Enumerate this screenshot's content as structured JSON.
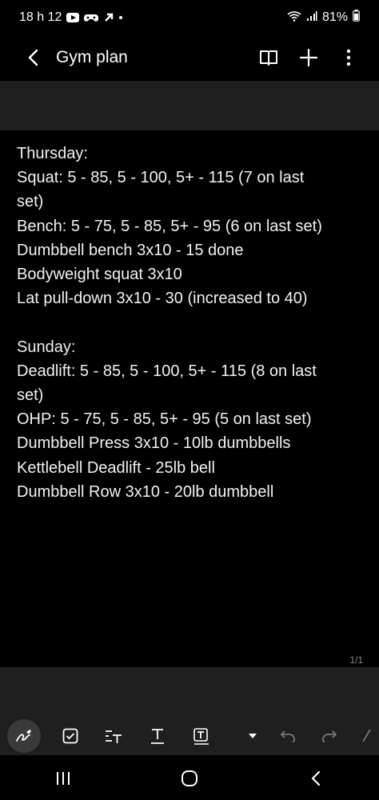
{
  "status_bar": {
    "time": "18 h 12",
    "battery": "81%",
    "icons": [
      "youtube-icon",
      "game-controller-icon",
      "arrow-up-right-icon",
      "dot-icon",
      "wifi-icon",
      "signal-icon",
      "battery-icon"
    ]
  },
  "app_bar": {
    "title": "Gym plan",
    "icons": [
      "back-icon",
      "book-icon",
      "add-icon",
      "more-vert-icon"
    ]
  },
  "note": {
    "lines": [
      "Thursday:",
      "Squat: 5 - 85, 5 - 100, 5+ - 115 (7 on last",
      "set)",
      "Bench: 5 - 75, 5 - 85, 5+ - 95 (6 on last set)",
      "Dumbbell bench 3x10 - 15 done",
      "Bodyweight squat 3x10",
      "Lat pull-down 3x10 - 30 (increased to 40)",
      "",
      "Sunday:",
      "Deadlift: 5 - 85, 5 - 100, 5+ - 115 (8 on last",
      "set)",
      "OHP: 5 - 75, 5 - 85, 5+ - 95 (5 on last set)",
      "Dumbbell Press 3x10 - 10lb dumbbells",
      "Kettlebell Deadlift - 25lb bell",
      "Dumbbell Row 3x10 - 20lb dumbbell"
    ]
  },
  "page_indicator": "1/1",
  "bottom_tools": [
    "pen-icon",
    "checkbox-icon",
    "text-format-icon",
    "text-style-icon",
    "text-box-icon",
    "dropdown-icon",
    "undo-icon",
    "redo-icon",
    "eraser-icon"
  ],
  "nav_bar": [
    "recents-icon",
    "home-icon",
    "back-nav-icon"
  ],
  "colors": {
    "background": "#000000",
    "panel": "#1f1f1f",
    "text": "#f2f2f2",
    "muted": "#8a8a8a"
  }
}
